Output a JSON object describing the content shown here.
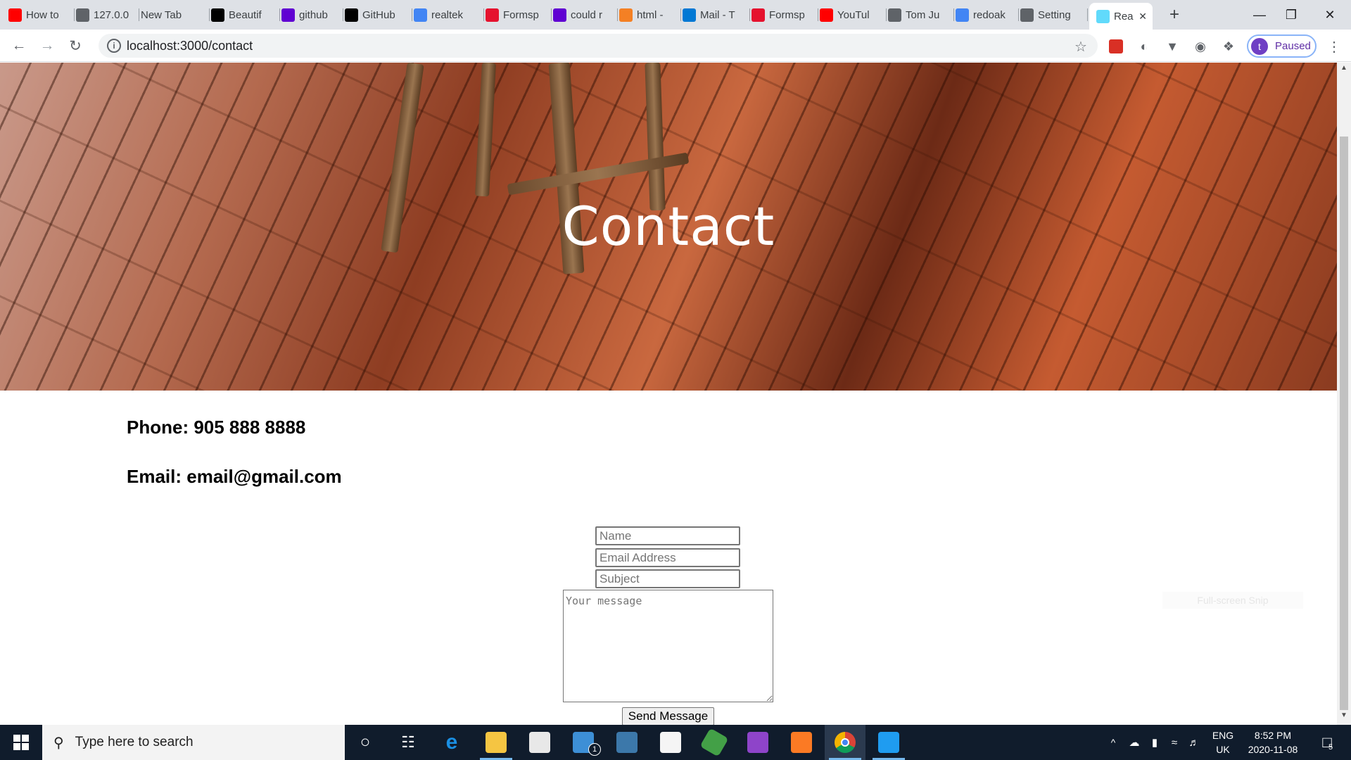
{
  "browser": {
    "tabs": [
      {
        "label": "How to",
        "icon": "youtube-icon",
        "color": "#ff0000"
      },
      {
        "label": "127.0.0",
        "icon": "globe-icon",
        "color": "#5f6368"
      },
      {
        "label": "New Tab",
        "icon": "",
        "color": ""
      },
      {
        "label": "Beautif",
        "icon": "unsplash-icon",
        "color": "#000000"
      },
      {
        "label": "github",
        "icon": "yahoo-icon",
        "color": "#6001d2"
      },
      {
        "label": "GitHub",
        "icon": "github-icon",
        "color": "#000000"
      },
      {
        "label": "realtek",
        "icon": "google-icon",
        "color": "#4285f4"
      },
      {
        "label": "Formsp",
        "icon": "formspree-icon",
        "color": "#e5122e"
      },
      {
        "label": "could r",
        "icon": "yahoo-icon",
        "color": "#6001d2"
      },
      {
        "label": "html -",
        "icon": "stackoverflow-icon",
        "color": "#f48024"
      },
      {
        "label": "Mail - T",
        "icon": "outlook-icon",
        "color": "#0078d4"
      },
      {
        "label": "Formsp",
        "icon": "formspree-icon",
        "color": "#e5122e"
      },
      {
        "label": "YouTul",
        "icon": "youtube-icon",
        "color": "#ff0000"
      },
      {
        "label": "Tom Ju",
        "icon": "globe-icon",
        "color": "#5f6368"
      },
      {
        "label": "redoak",
        "icon": "google-icon",
        "color": "#4285f4"
      },
      {
        "label": "Setting",
        "icon": "globe-icon",
        "color": "#5f6368"
      },
      {
        "label": "Rea",
        "icon": "react-icon",
        "color": "#61dafb"
      }
    ],
    "new_tab_symbol": "+",
    "close_tab_symbol": "✕",
    "url": "localhost:3000/contact",
    "profile_initial": "t",
    "profile_status": "Paused"
  },
  "page": {
    "hero_title": "Contact",
    "phone": "Phone: 905 888 8888",
    "email": "Email: email@gmail.com",
    "form": {
      "name_placeholder": "Name",
      "email_placeholder": "Email Address",
      "subject_placeholder": "Subject",
      "message_placeholder": "Your message",
      "send_label": "Send Message"
    },
    "snip_overlay": "Full-screen Snip"
  },
  "taskbar": {
    "search_placeholder": "Type here to search",
    "mail_badge": "1",
    "language_top": "ENG",
    "language_bottom": "UK",
    "time": "8:52 PM",
    "date": "2020-11-08",
    "notification_count": "5",
    "accent": "#101c2c"
  }
}
